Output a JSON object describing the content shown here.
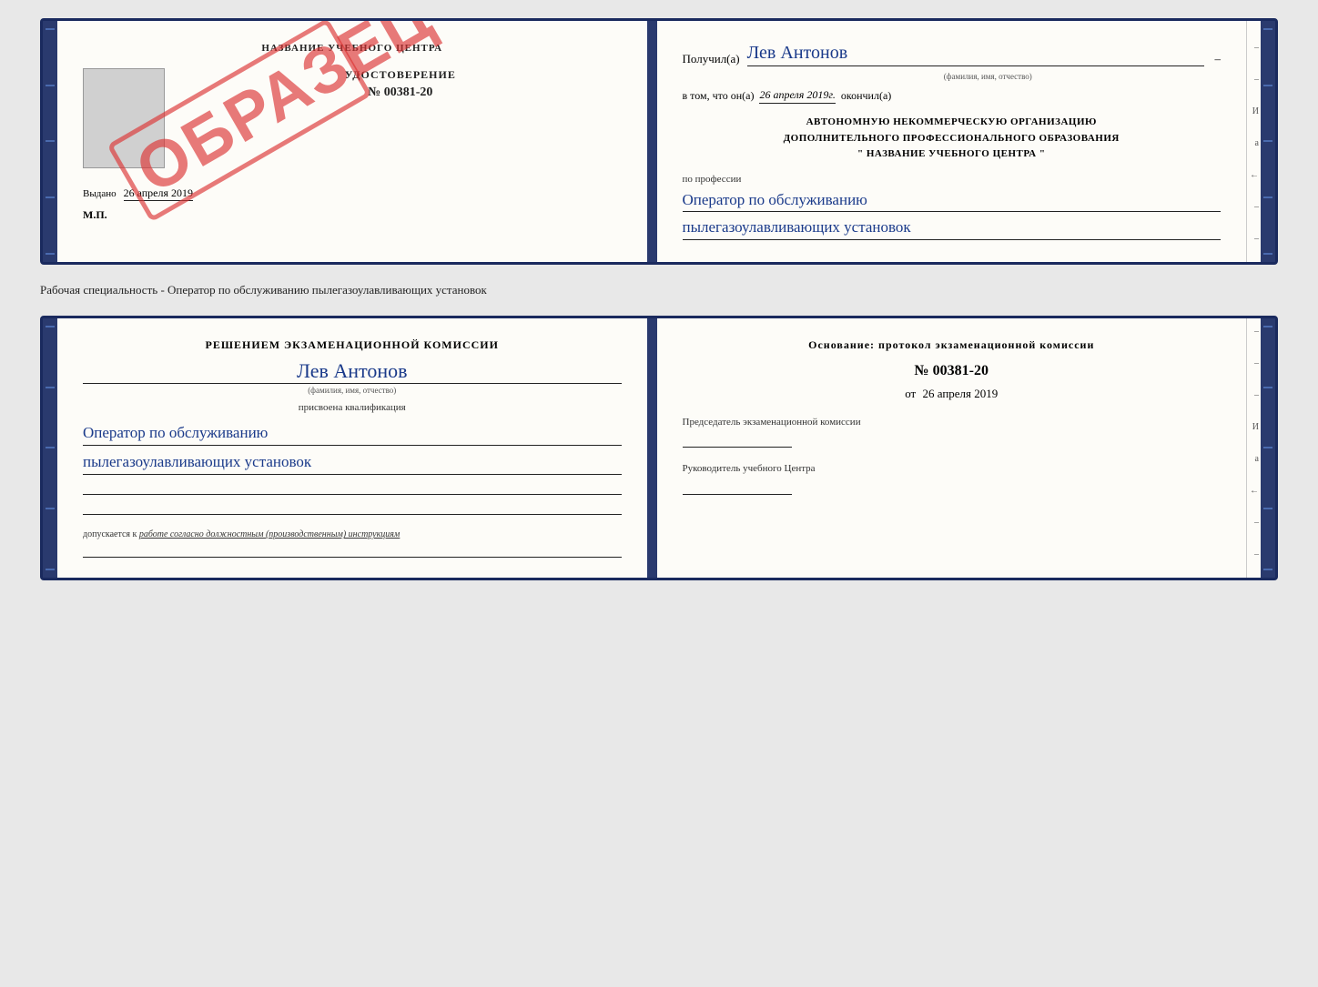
{
  "top": {
    "left": {
      "header": "НАЗВАНИЕ УЧЕБНОГО ЦЕНТРА",
      "cert_label": "УДОСТОВЕРЕНИЕ",
      "cert_number": "№ 00381-20",
      "stamp_text": "ОБРАЗЕЦ",
      "date_prefix": "Выдано",
      "date_value": "26 апреля 2019",
      "mp_label": "М.П."
    },
    "right": {
      "poluchil_prefix": "Получил(а)",
      "poluchil_name": "Лев Антонов",
      "fio_label": "(фамилия, имя, отчество)",
      "vtom_prefix": "в том, что он(а)",
      "vtom_date": "26 апреля 2019г.",
      "okonchil": "окончил(а)",
      "org_line1": "АВТОНОМНУЮ НЕКОММЕРЧЕСКУЮ ОРГАНИЗАЦИЮ",
      "org_line2": "ДОПОЛНИТЕЛЬНОГО ПРОФЕССИОНАЛЬНОГО ОБРАЗОВАНИЯ",
      "org_line3": "\"  НАЗВАНИЕ УЧЕБНОГО ЦЕНТРА  \"",
      "profession_label": "по профессии",
      "profession_line1": "Оператор по обслуживанию",
      "profession_line2": "пылегазоулавливающих установок"
    }
  },
  "middle_text": "Рабочая специальность - Оператор по обслуживанию пылегазоулавливающих установок",
  "bottom": {
    "left": {
      "resheniem": "Решением экзаменационной комиссии",
      "person_name": "Лев Антонов",
      "fio_label": "(фамилия, имя, отчество)",
      "prisvoena": "присвоена квалификация",
      "qualification_line1": "Оператор по обслуживанию",
      "qualification_line2": "пылегазоулавливающих установок",
      "dopuskaetsya_prefix": "допускается к",
      "dopuskaetsya_value": "работе согласно должностным (производственным) инструкциям"
    },
    "right": {
      "osnovanie": "Основание: протокол экзаменационной комиссии",
      "protocol_number": "№ 00381-20",
      "ot_prefix": "от",
      "ot_date": "26 апреля 2019",
      "predsedatel_label": "Председатель экзаменационной комиссии",
      "rukovoditel_label": "Руководитель учебного Центра"
    }
  },
  "side_chars": {
    "letters": "И а ←"
  }
}
